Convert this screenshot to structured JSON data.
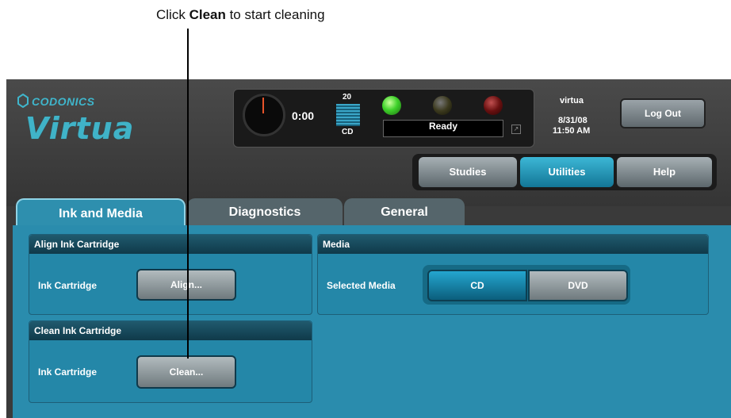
{
  "callout": {
    "prefix": "Click ",
    "bold": "Clean",
    "suffix": " to start cleaning"
  },
  "logo": {
    "brand": "CODONICS",
    "product": "Virtua"
  },
  "status": {
    "timer": "0:00",
    "disc_count": "20",
    "disc_type": "CD",
    "state": "Ready",
    "user": "virtua",
    "date": "8/31/08",
    "time": "11:50 AM",
    "logout_label": "Log Out"
  },
  "nav": {
    "studies": "Studies",
    "utilities": "Utilities",
    "help": "Help",
    "active": "Utilities"
  },
  "tabs": {
    "ink_media": "Ink and Media",
    "diagnostics": "Diagnostics",
    "general": "General",
    "active": "Ink and Media"
  },
  "align_group": {
    "title": "Align Ink Cartridge",
    "label": "Ink Cartridge",
    "button": "Align..."
  },
  "clean_group": {
    "title": "Clean Ink Cartridge",
    "label": "Ink Cartridge",
    "button": "Clean..."
  },
  "media_group": {
    "title": "Media",
    "label": "Selected Media",
    "options": [
      "CD",
      "DVD"
    ],
    "selected": "CD"
  },
  "colors": {
    "accent": "#2a8cad",
    "active_blue": "#24a6cf",
    "ready_led": "#3fd22a"
  }
}
